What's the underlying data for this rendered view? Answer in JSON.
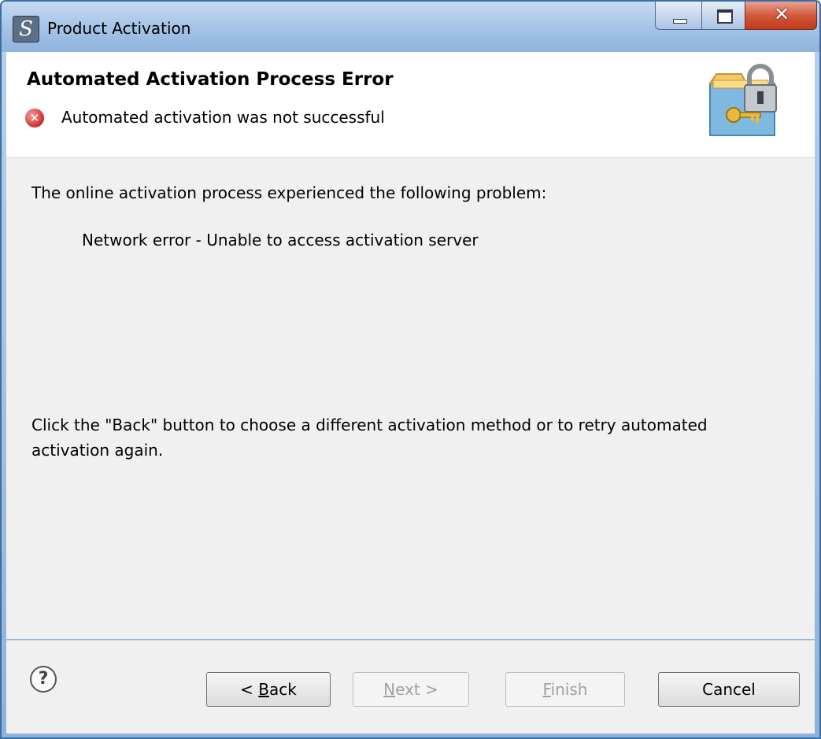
{
  "window": {
    "title": "Product Activation"
  },
  "header": {
    "title": "Automated Activation Process Error",
    "subtitle": "Automated activation was not successful"
  },
  "content": {
    "intro": "The online activation process experienced the following problem:",
    "error_detail": "Network error - Unable to access activation server",
    "hint_line1": "Click the \"Back\" button to choose a different activation method or to retry automated",
    "hint_line2": "activation again."
  },
  "buttons": {
    "back": {
      "prefix": "< ",
      "mnemonic": "B",
      "rest": "ack"
    },
    "next": {
      "mnemonic": "N",
      "rest": "ext >"
    },
    "finish": {
      "mnemonic": "F",
      "rest": "inish"
    },
    "cancel": "Cancel"
  },
  "icons": {
    "app": "app-logo-icon",
    "error": "error-icon",
    "banner": "lock-key-folder-icon",
    "help": "help-icon"
  },
  "colors": {
    "error_red": "#d12e2e",
    "close_red": "#c0391a",
    "titlebar_blue": "#a9c6e8"
  }
}
